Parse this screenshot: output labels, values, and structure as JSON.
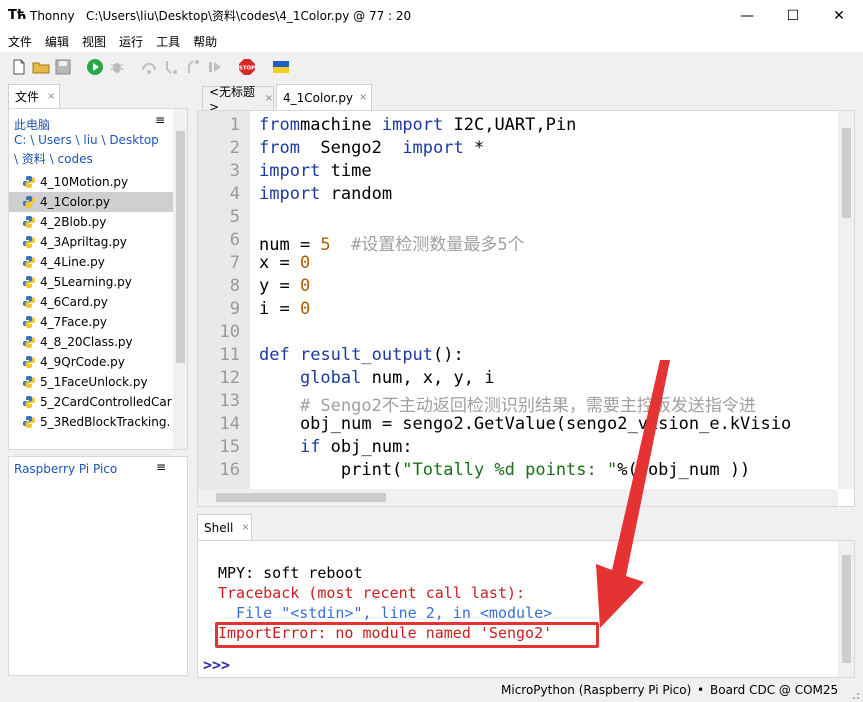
{
  "window": {
    "app_name": "Thonny",
    "title_rest": "C:\\Users\\liu\\Desktop\\资料\\codes\\4_1Color.py  @  77 : 20",
    "minimize": "—",
    "maximize": "☐",
    "close": "✕"
  },
  "menu": [
    "文件",
    "编辑",
    "视图",
    "运行",
    "工具",
    "帮助"
  ],
  "toolbar": {
    "icons": [
      "new-file-icon",
      "open-folder-icon",
      "save-icon",
      "run-icon",
      "debug-icon",
      "step-over-icon",
      "step-into-icon",
      "step-out-icon",
      "resume-icon",
      "stop-icon",
      "ukraine-flag-icon"
    ],
    "stop_label": "STOP"
  },
  "files_panel": {
    "tab_label": "文件",
    "tab_close": "×",
    "path": [
      "此电脑",
      "C: \\ Users \\ liu \\ Desktop",
      "\\ 资料 \\ codes"
    ],
    "files": [
      "4_10Motion.py",
      "4_1Color.py",
      "4_2Blob.py",
      "4_3Apriltag.py",
      "4_4Line.py",
      "4_5Learning.py",
      "4_6Card.py",
      "4_7Face.py",
      "4_8_20Class.py",
      "4_9QrCode.py",
      "5_1FaceUnlock.py",
      "5_2CardControlledCar",
      "5_3RedBlockTracking."
    ],
    "selected_index": 1,
    "menu_glyph": "≡"
  },
  "device_panel": {
    "label": "Raspberry Pi Pico",
    "menu_glyph": "≡"
  },
  "editor": {
    "tabs": [
      {
        "label": "<无标题>",
        "active": false,
        "close": "×"
      },
      {
        "label": "4_1Color.py",
        "active": true,
        "close": "×"
      }
    ],
    "lines": [
      {
        "n": "1",
        "tokens": [
          [
            "kw",
            "from"
          ],
          [
            "",
            "machine "
          ],
          [
            "kw",
            "import"
          ],
          [
            "",
            " I2C,UART,Pin"
          ]
        ]
      },
      {
        "n": "2",
        "tokens": [
          [
            "kw",
            "from"
          ],
          [
            "",
            "  Sengo2  "
          ],
          [
            "kw",
            "import"
          ],
          [
            "",
            " *"
          ]
        ]
      },
      {
        "n": "3",
        "tokens": [
          [
            "kw",
            "import"
          ],
          [
            "",
            " time"
          ]
        ]
      },
      {
        "n": "4",
        "tokens": [
          [
            "kw",
            "import"
          ],
          [
            "",
            " random"
          ]
        ]
      },
      {
        "n": "5",
        "tokens": []
      },
      {
        "n": "6",
        "tokens": [
          [
            "",
            "num = "
          ],
          [
            "num",
            "5"
          ],
          [
            "",
            "  "
          ],
          [
            "cmt",
            "#设置检测数量最多5个"
          ]
        ]
      },
      {
        "n": "7",
        "tokens": [
          [
            "",
            "x = "
          ],
          [
            "num",
            "0"
          ]
        ]
      },
      {
        "n": "8",
        "tokens": [
          [
            "",
            "y = "
          ],
          [
            "num",
            "0"
          ]
        ]
      },
      {
        "n": "9",
        "tokens": [
          [
            "",
            "i = "
          ],
          [
            "num",
            "0"
          ]
        ]
      },
      {
        "n": "10",
        "tokens": []
      },
      {
        "n": "11",
        "tokens": [
          [
            "kw",
            "def"
          ],
          [
            "",
            " "
          ],
          [
            "kw",
            "result_output"
          ],
          [
            "",
            "():"
          ]
        ]
      },
      {
        "n": "12",
        "tokens": [
          [
            "",
            "    "
          ],
          [
            "kw",
            "global"
          ],
          [
            "",
            " num, x, y, i"
          ]
        ]
      },
      {
        "n": "13",
        "tokens": [
          [
            "",
            "    "
          ],
          [
            "cmt",
            "# Sengo2不主动返回检测识别结果，需要主控板发送指令进"
          ]
        ]
      },
      {
        "n": "14",
        "tokens": [
          [
            "",
            "    obj_num = sengo2.GetValue(sengo2_vision_e.kVisio"
          ]
        ]
      },
      {
        "n": "15",
        "tokens": [
          [
            "",
            "    "
          ],
          [
            "kw",
            "if"
          ],
          [
            "",
            " obj_num:"
          ]
        ]
      },
      {
        "n": "16",
        "tokens": [
          [
            "",
            "        print("
          ],
          [
            "str",
            "\"Totally %d points: \""
          ],
          [
            "",
            "%( obj_num ))"
          ]
        ]
      }
    ]
  },
  "shell": {
    "tab_label": "Shell",
    "tab_close": "×",
    "lines": [
      {
        "text": "MPY: soft reboot",
        "color": "#000000"
      },
      {
        "text": "Traceback (most recent call last):",
        "color": "#c81e1e"
      },
      {
        "text": "  File \"<stdin>\", line 2, in <module>",
        "color": "#3a6fd8"
      },
      {
        "text": "ImportError: no module named 'Sengo2'",
        "color": "#c81e1e"
      }
    ],
    "prompt": ">>>"
  },
  "status": {
    "interpreter": "MicroPython (Raspberry Pi Pico)",
    "separator": "•",
    "port": "Board CDC @ COM25"
  },
  "annotation": {
    "color": "#e53333"
  }
}
